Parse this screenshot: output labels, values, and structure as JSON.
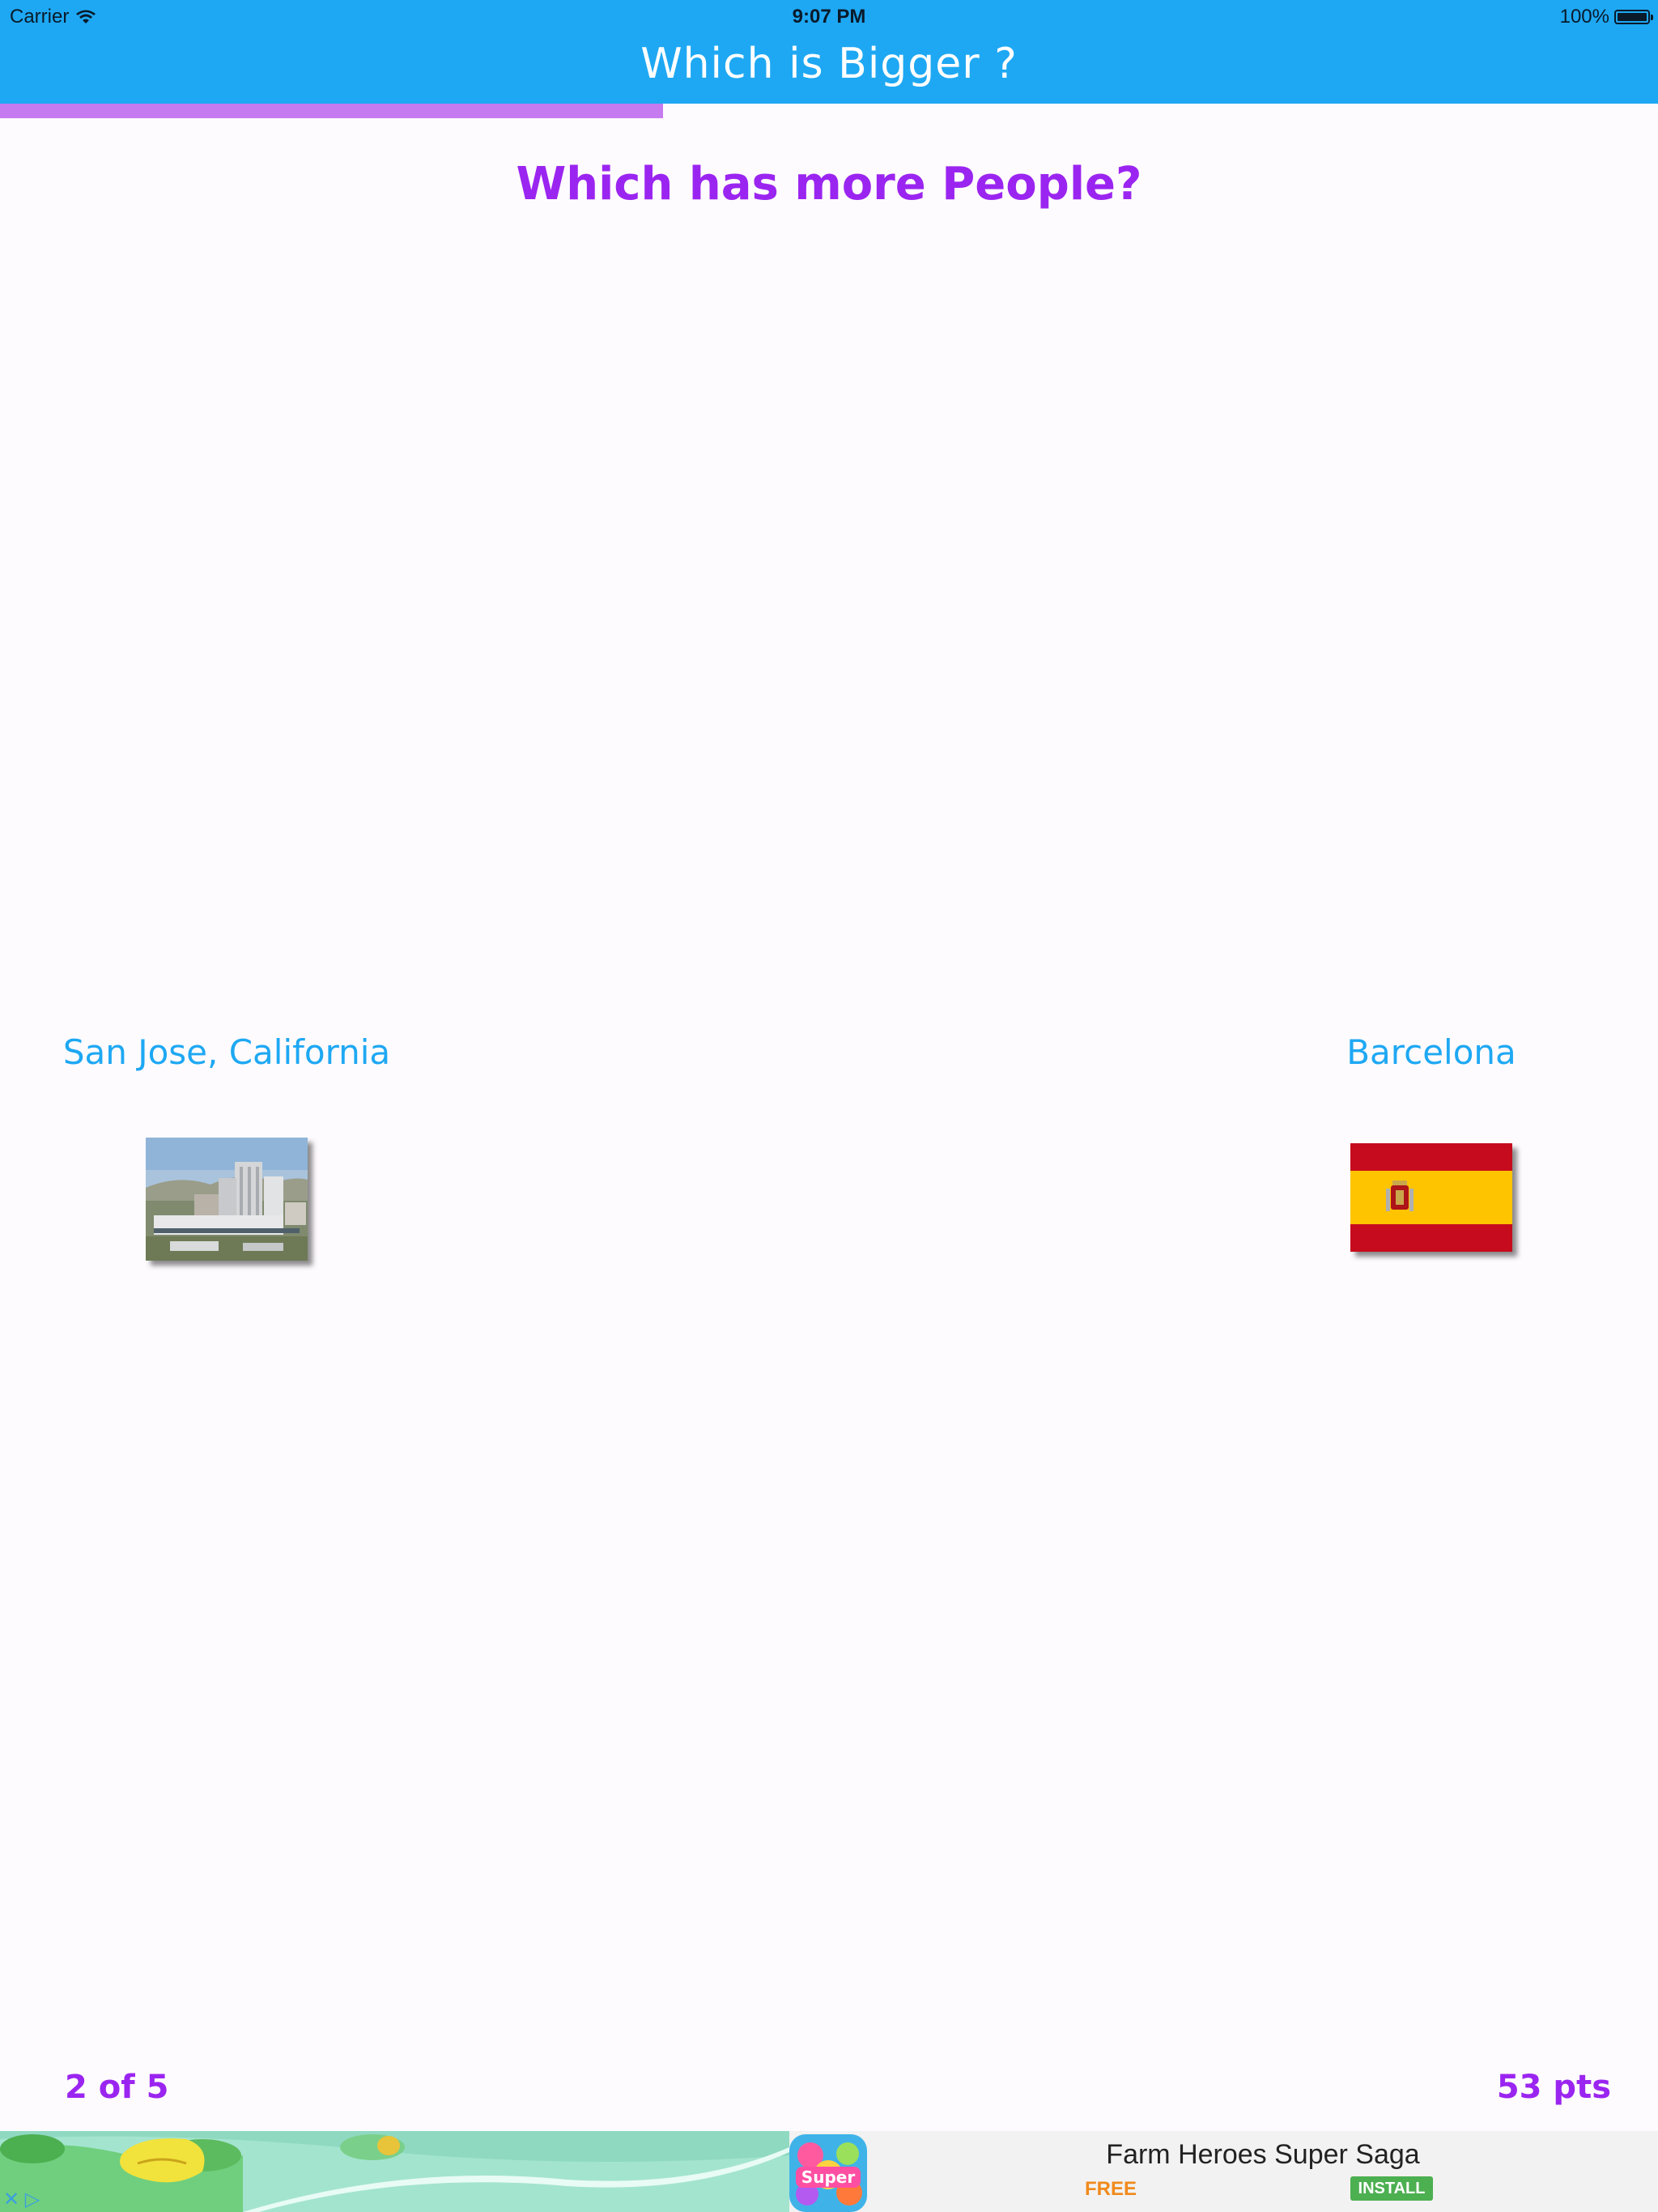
{
  "status_bar": {
    "carrier": "Carrier",
    "time": "9:07 PM",
    "battery": "100%"
  },
  "nav": {
    "title": "Which is Bigger ?"
  },
  "quiz": {
    "progress_fraction": 0.4,
    "question": "Which has more People?",
    "option_left": {
      "label": "San Jose, California"
    },
    "option_right": {
      "label": "Barcelona"
    }
  },
  "footer": {
    "counter": "2 of 5",
    "points": "53 pts"
  },
  "ad": {
    "title": "Farm Heroes Super Saga",
    "price": "FREE",
    "install_label": "INSTALL",
    "icon_text": "Super"
  },
  "colors": {
    "bar_blue": "#1ea8f3",
    "question_purple": "#9b25f0",
    "progress_purple": "#c67af0"
  }
}
